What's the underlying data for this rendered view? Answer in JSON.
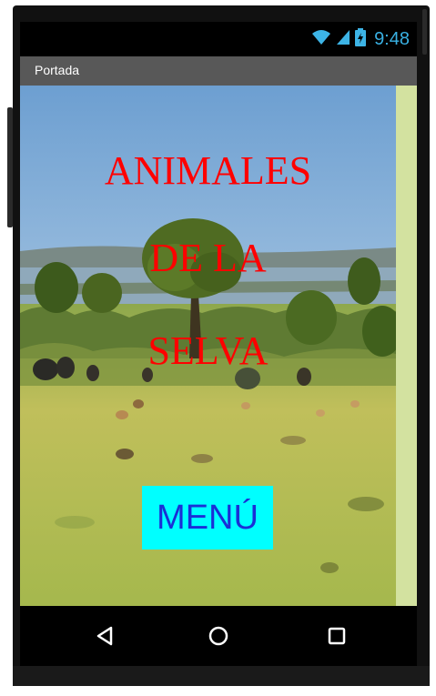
{
  "status_bar": {
    "time": "9:48",
    "icons": [
      "wifi-icon",
      "signal-icon",
      "battery-charging-icon"
    ]
  },
  "title_bar": {
    "title": "Portada"
  },
  "screen": {
    "headline_line1": "ANIMALES",
    "headline_line2": "DE LA",
    "headline_line3": "SELVA",
    "menu_button_label": "MENÚ",
    "background_image": "savanna-landscape-with-trees-and-animals"
  },
  "nav_bar": {
    "buttons": [
      "back-icon",
      "home-icon",
      "recent-apps-icon"
    ]
  },
  "colors": {
    "headline": "#ff0000",
    "menu_button_bg": "#00ffff",
    "menu_button_text": "#1a2fd6",
    "title_bar_bg": "#585858",
    "status_icons": "#3db4e6",
    "side_strip": "#d3e2a0"
  }
}
